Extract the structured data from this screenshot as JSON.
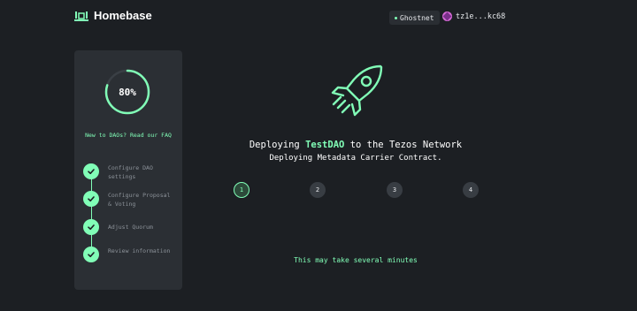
{
  "header": {
    "brand_name": "Homebase",
    "network": "Ghostnet",
    "wallet_address": "tz1e...kc68"
  },
  "sidebar": {
    "progress_label": "80%",
    "progress_value": 0.8,
    "faq_link": "New to DAOs? Read our FAQ",
    "steps": [
      {
        "label": "Configure DAO settings",
        "completed": true
      },
      {
        "label": "Configure Proposal & Voting",
        "completed": true
      },
      {
        "label": "Adjust Quorum",
        "completed": true
      },
      {
        "label": "Review information",
        "completed": true
      }
    ]
  },
  "main": {
    "title_prefix": "Deploying",
    "dao_name": "TestDAO",
    "title_suffix": "to the Tezos Network",
    "subtitle": "Deploying Metadata Carrier Contract.",
    "stepper": [
      "1",
      "2",
      "3",
      "4"
    ],
    "active_step": 1,
    "note": "This may take several minutes"
  },
  "colors": {
    "accent": "#81feb7",
    "background": "#1c1f23",
    "panel": "#2b2f34"
  },
  "icons": [
    "homebase-logo-icon",
    "avatar-icon",
    "rocket-icon",
    "check-icon"
  ]
}
